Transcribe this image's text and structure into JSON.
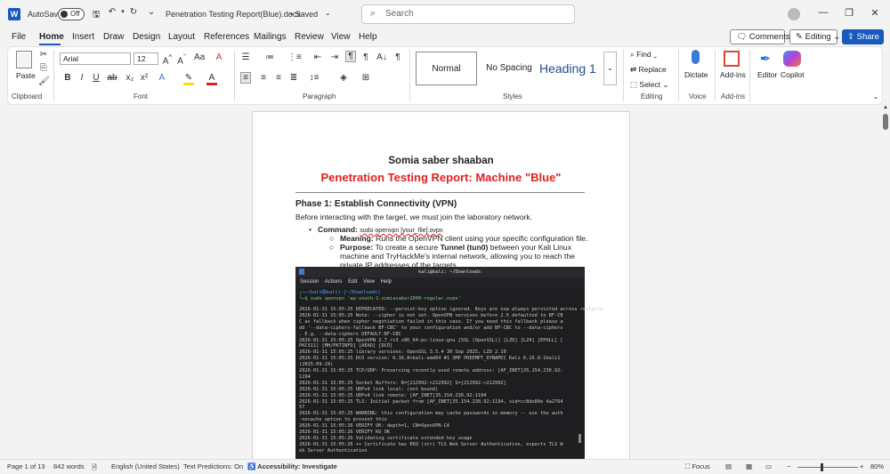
{
  "titlebar": {
    "autosave_label": "AutoSave",
    "autosave_state": "Off",
    "document_title": "Penetration Testing Report(Blue).docx",
    "saved_status": "• Saved",
    "search_placeholder": "Search"
  },
  "menu": {
    "tabs": [
      "File",
      "Home",
      "Insert",
      "Draw",
      "Design",
      "Layout",
      "References",
      "Mailings",
      "Review",
      "View",
      "Help"
    ],
    "comments_label": "Comments",
    "editing_label": "Editing",
    "share_label": "Share"
  },
  "ribbon": {
    "paste_label": "Paste",
    "clipboard_label": "Clipboard",
    "font_name": "Arial",
    "font_size": "12",
    "font_label": "Font",
    "paragraph_label": "Paragraph",
    "styles": [
      "Normal",
      "No Spacing",
      "Heading 1"
    ],
    "styles_label": "Styles",
    "find_label": "Find",
    "replace_label": "Replace",
    "select_label": "Select",
    "editing_group_label": "Editing",
    "dictate_label": "Dictate",
    "voice_label": "Voice",
    "addins_label": "Add-ins",
    "addins_group_label": "Add-ins",
    "editor_label": "Editor",
    "copilot_label": "Copilot"
  },
  "document": {
    "author": "Somia saber shaaban",
    "title": "Penetration Testing Report: Machine \"Blue\"",
    "phase_heading": "Phase 1: Establish Connectivity (VPN)",
    "intro": "Before interacting with the target, we must join the laboratory network.",
    "command_label": "Command:",
    "command_value": "sudo openvpn [your_file].ovpn",
    "meaning_label": "Meaning:",
    "meaning_text": "Runs the OpenVPN client using your specific configuration file.",
    "purpose_label": "Purpose:",
    "purpose_text_1": "To create a secure ",
    "purpose_bold": "Tunnel (tun0)",
    "purpose_text_2": " between your Kali Linux",
    "purpose_line2": "machine and TryHackMe's internal network, allowing you to reach the",
    "purpose_line3": "private IP addresses of the targets."
  },
  "terminal": {
    "window_title": "kali@kali: ~/Downloads",
    "menu": [
      "Session",
      "Actions",
      "Edit",
      "View",
      "Help"
    ],
    "prompt": "┌──(kali㉿kali)-[~/Downloads]",
    "command": "└─$ sudo openvpn 'ap-south-1-somiasaber2000-regular.ovpn'",
    "lines": [
      "2026-01-31 15:05:25 DEPRECATED: --persist-key option ignored. Keys are now always persisted across restarts.",
      "2026-01-31 15:05:25 Note: --cipher is not set. OpenVPN versions before 2.5 defaulted to BF-CB",
      "C as fallback when cipher negotiation failed in this case. If you need this fallback please a",
      "dd '--data-ciphers-fallback BF-CBC' to your configuration and/or add BF-CBC to --data-ciphers",
      ". E.g. --data-ciphers DEFAULT:BF-CBC",
      "2026-01-31 15:05:25 OpenVPN 2.7_rc3 x86_64-pc-linux-gnu [SSL (OpenSSL)] [LZO] [LZ4] [EPOLL] [",
      "PKCS11] [MH/PKTINFO] [AEAD] [DCO]",
      "2026-01-31 15:05:25 library versions: OpenSSL 3.5.4 30 Sep 2025, LZO 2.10",
      "2026-01-31 15:05:25 DCO version: 6.16.8+kali-amd64 #1 SMP PREEMPT_DYNAMIC Kali 6.16.8-1kali1",
      "(2025-09-24)",
      "2026-01-31 15:05:25 TCP/UDP: Preserving recently used remote address: [AF_INET]35.154.230.92:",
      "1194",
      "2026-01-31 15:05:25 Socket Buffers: R=[212992->212992] S=[212992->212992]",
      "2026-01-31 15:05:25 UDPv4 link local: (not bound)",
      "2026-01-31 15:05:25 UDPv4 link remote: [AF_INET]35.154.230.92:1194",
      "2026-01-31 15:05:25 TLS: Initial packet from [AF_INET]35.154.230.92:1194, sid=cc8de80e 4a2764",
      "57",
      "2026-01-31 15:05:25 WARNING: this configuration may cache passwords in memory -- use the auth",
      "-nocache option to prevent this",
      "2026-01-31 15:05:26 VERIFY OK: depth=1, CN=OpenVPN-CA",
      "2026-01-31 15:05:26 VERIFY KU OK",
      "2026-01-31 15:05:26 Validating certificate extended key usage",
      "2026-01-31 15:05:26 ++ Certificate has EKU (str) TLS Web Server Authentication, expects TLS W",
      "eb Server Authentication"
    ]
  },
  "statusbar": {
    "page": "Page 1 of 13",
    "words": "842 words",
    "language": "English (United States)",
    "predictions": "Text Predictions: On",
    "accessibility": "Accessibility: Investigate",
    "focus": "Focus",
    "zoom": "80%"
  },
  "colors": {
    "accent": "#185abd",
    "title_red": "#e02020"
  }
}
